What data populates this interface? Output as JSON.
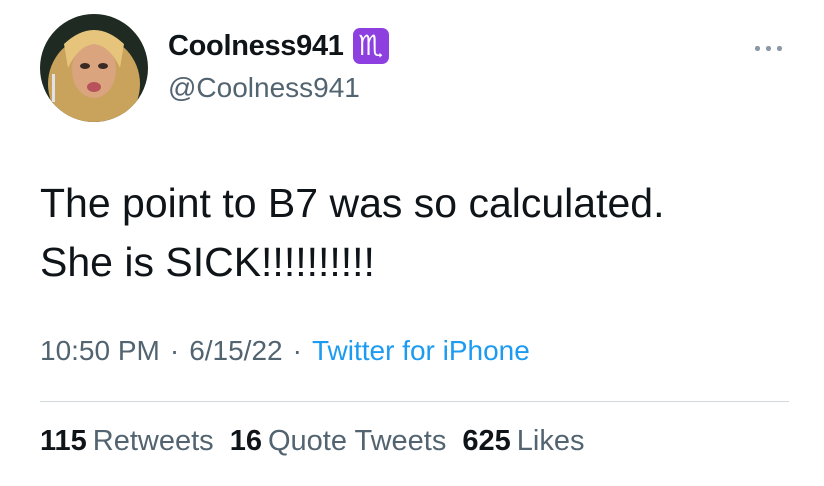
{
  "colors": {
    "accent": "#1d9bf0",
    "secondary_text": "#536471",
    "badge": "#8e3fe0"
  },
  "author": {
    "display_name": "Coolness941",
    "badge_glyph": "♏",
    "badge_icon": "scorpio-icon",
    "handle": "@Coolness941",
    "avatar": "profile-photo"
  },
  "more_icon": "more-horizontal-icon",
  "tweet": {
    "text": "The point to B7 was so calculated.\nShe is SICK!!!!!!!!!!",
    "time": "10:50 PM",
    "date": "6/15/22",
    "separator": "·",
    "source": "Twitter for iPhone"
  },
  "stats": [
    {
      "count": "115",
      "label": "Retweets"
    },
    {
      "count": "16",
      "label": "Quote Tweets"
    },
    {
      "count": "625",
      "label": "Likes"
    }
  ]
}
